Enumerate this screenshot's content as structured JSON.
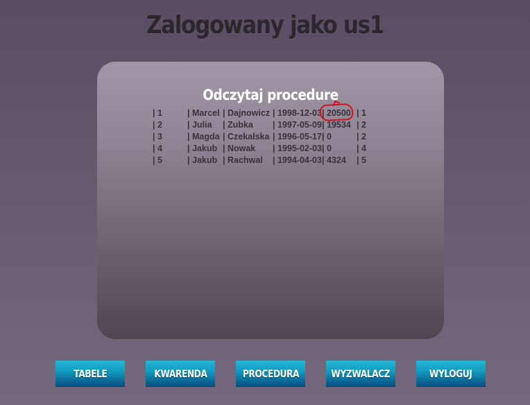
{
  "header": {
    "title": "Zalogowany jako us1"
  },
  "panel": {
    "title": "Odczytaj procedure",
    "rows": [
      {
        "id": "| 1",
        "first": "| Marcel",
        "last": "| Dajnowicz",
        "date": "| 1998-12-03",
        "value": "| 20500",
        "group": "| 1"
      },
      {
        "id": "| 2",
        "first": "| Julia",
        "last": "| Zubka",
        "date": "| 1997-05-09",
        "value": "| 19534",
        "group": "| 2"
      },
      {
        "id": "| 3",
        "first": "| Magda",
        "last": "| Czekalska",
        "date": "| 1996-05-17",
        "value": "| 0",
        "group": "| 2"
      },
      {
        "id": "| 4",
        "first": "| Jakub",
        "last": "| Nowak",
        "date": "| 1995-02-03",
        "value": "| 0",
        "group": "| 4"
      },
      {
        "id": "| 5",
        "first": "| Jakub",
        "last": "| Rachwal",
        "date": "| 1994-04-03",
        "value": "| 4324",
        "group": "| 5"
      }
    ]
  },
  "annotation": {
    "color": "#d1121e"
  },
  "nav": {
    "tabele": "TABELE",
    "kwarenda": "KWARENDA",
    "procedura": "PROCEDURA",
    "wyzwalacz": "WYZWALACZ",
    "wyloguj": "WYLOGUJ"
  }
}
